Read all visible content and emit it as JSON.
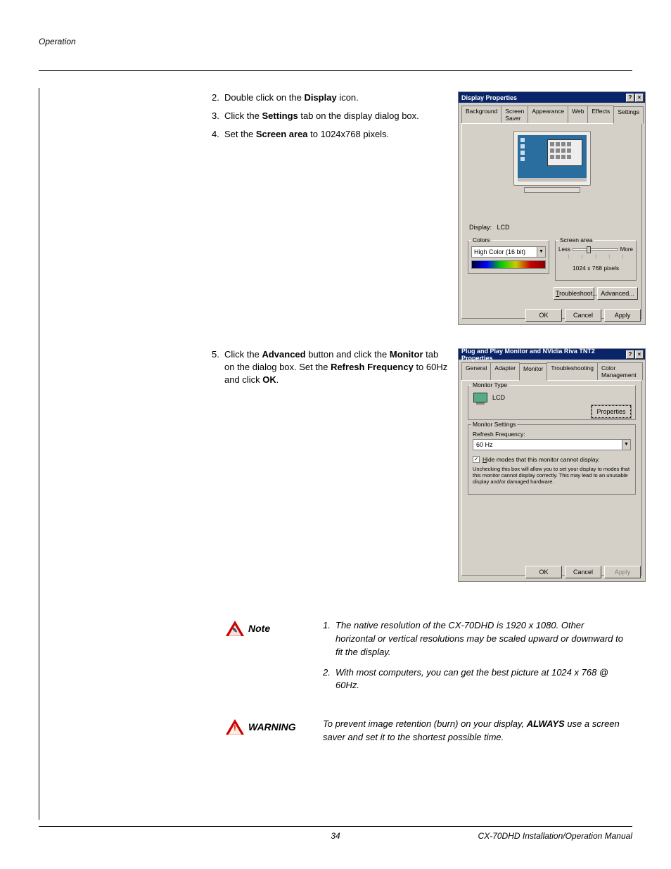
{
  "header": {
    "section": "Operation"
  },
  "steps1": {
    "s2": {
      "num": "2.",
      "pre": "Double click on the ",
      "bold": "Display",
      "post": " icon."
    },
    "s3": {
      "num": "3.",
      "pre": "Click the ",
      "bold": "Settings",
      "post": " tab on the display dialog box."
    },
    "s4": {
      "num": "4.",
      "pre": "Set the ",
      "bold": "Screen area",
      "post": " to 1024x768 pixels."
    }
  },
  "steps2": {
    "s5": {
      "num": "5.",
      "pre": "Click the ",
      "b1": "Advanced",
      "mid1": " button and click the ",
      "b2": "Monitor",
      "mid2": " tab on the dialog box. Set the ",
      "b3": "Refresh Frequency",
      "mid3": " to 60Hz and click ",
      "b4": "OK",
      "post": "."
    }
  },
  "dialog1": {
    "title": "Display Properties",
    "tabs": {
      "t1": "Background",
      "t2": "Screen Saver",
      "t3": "Appearance",
      "t4": "Web",
      "t5": "Effects",
      "t6": "Settings"
    },
    "display_label": "Display:",
    "display_value": "LCD",
    "colors_legend": "Colors",
    "colors_value": "High Color (16 bit)",
    "screen_legend": "Screen area",
    "less": "Less",
    "more": "More",
    "screen_value": "1024 x 768 pixels",
    "troubleshoot": "Troubleshoot...",
    "advanced": "Advanced...",
    "ok": "OK",
    "cancel": "Cancel",
    "apply": "Apply"
  },
  "dialog2": {
    "title": "Plug and Play Monitor and NVidia Riva TNT2 Properties",
    "tabs": {
      "t1": "General",
      "t2": "Adapter",
      "t3": "Monitor",
      "t4": "Troubleshooting",
      "t5": "Color Management"
    },
    "montype_legend": "Monitor Type",
    "monitor_name": "LCD",
    "properties": "Properties",
    "monset_legend": "Monitor Settings",
    "rf_label": "Refresh Frequency:",
    "rf_value": "60 Hz",
    "hide_label": "Hide modes that this monitor cannot display.",
    "hint": "Unchecking this box will allow you to set your display to modes that this monitor cannot display correctly. This may lead to an unusable display and/or damaged hardware.",
    "ok": "OK",
    "cancel": "Cancel",
    "apply": "Apply"
  },
  "note": {
    "label": "Note",
    "n1_num": "1.",
    "n1": "The native resolution of the CX-70DHD is 1920 x 1080. Other horizontal or vertical resolutions may be scaled upward or downward to fit the display.",
    "n2_num": "2.",
    "n2": "With most computers, you can get the best picture at 1024 x 768 @ 60Hz."
  },
  "warning": {
    "label": "WARNING",
    "pre": "To prevent image retention (burn) on your display, ",
    "bold": "ALWAYS",
    "post": " use a screen saver and set it to the shortest possible time."
  },
  "footer": {
    "page": "34",
    "doc": "CX-70DHD Installation/Operation Manual"
  }
}
